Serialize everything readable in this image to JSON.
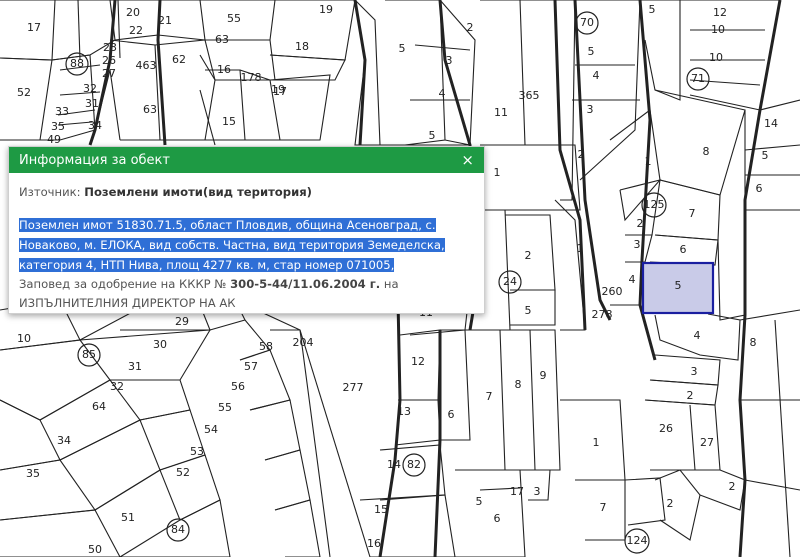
{
  "popup": {
    "title": "Информация за обект",
    "close_glyph": "×",
    "source_label": "Източник:",
    "source_value": "Поземлени имоти(вид територия)",
    "description_lines": [
      "Поземлен имот 51830.71.5, област Пловдив, община Асеновград, с.",
      "Новаково, м. ЕЛОКА, вид собств. Частна, вид територия Земеделска,",
      "категория 4, НТП Нива, площ 4277 кв. м, стар номер 071005,"
    ],
    "order_line1_prefix": "Заповед за одобрение на КККР № ",
    "order_number": "300-5-44/11.06.2004 г.",
    "order_line1_suffix": " на",
    "order_line2": "ИЗПЪЛНИТЕЛНИЯ ДИРЕКТОР НА АК"
  },
  "watermark": "Cadastre watermark",
  "map": {
    "selected_parcel_label": "5",
    "selected_fill": "#c9cbe8",
    "selected_stroke": "#1a1fa0",
    "section_numbers": [
      "88",
      "70",
      "71",
      "125",
      "24",
      "85",
      "82",
      "84",
      "124"
    ],
    "parcel_labels": [
      "17",
      "20",
      "21",
      "19",
      "55",
      "63",
      "18",
      "19",
      "23",
      "22",
      "52",
      "26",
      "27",
      "463",
      "62",
      "16",
      "178",
      "17",
      "32",
      "31",
      "33",
      "35",
      "34",
      "63",
      "15",
      "49",
      "5",
      "2",
      "3",
      "4",
      "5",
      "365",
      "11",
      "5",
      "3",
      "4",
      "2",
      "1",
      "12",
      "10",
      "10",
      "14",
      "5",
      "6",
      "8",
      "1",
      "7",
      "6",
      "2",
      "3",
      "1",
      "4",
      "5",
      "2",
      "5",
      "260",
      "278",
      "4",
      "8",
      "3",
      "2",
      "26",
      "27",
      "2",
      "11",
      "12",
      "13",
      "29",
      "30",
      "31",
      "32",
      "64",
      "34",
      "35",
      "51",
      "50",
      "58",
      "57",
      "56",
      "55",
      "54",
      "53",
      "52",
      "204",
      "277",
      "10",
      "6",
      "7",
      "8",
      "9",
      "14",
      "15",
      "16",
      "5",
      "6",
      "17",
      "3",
      "1",
      "7",
      "2"
    ]
  }
}
